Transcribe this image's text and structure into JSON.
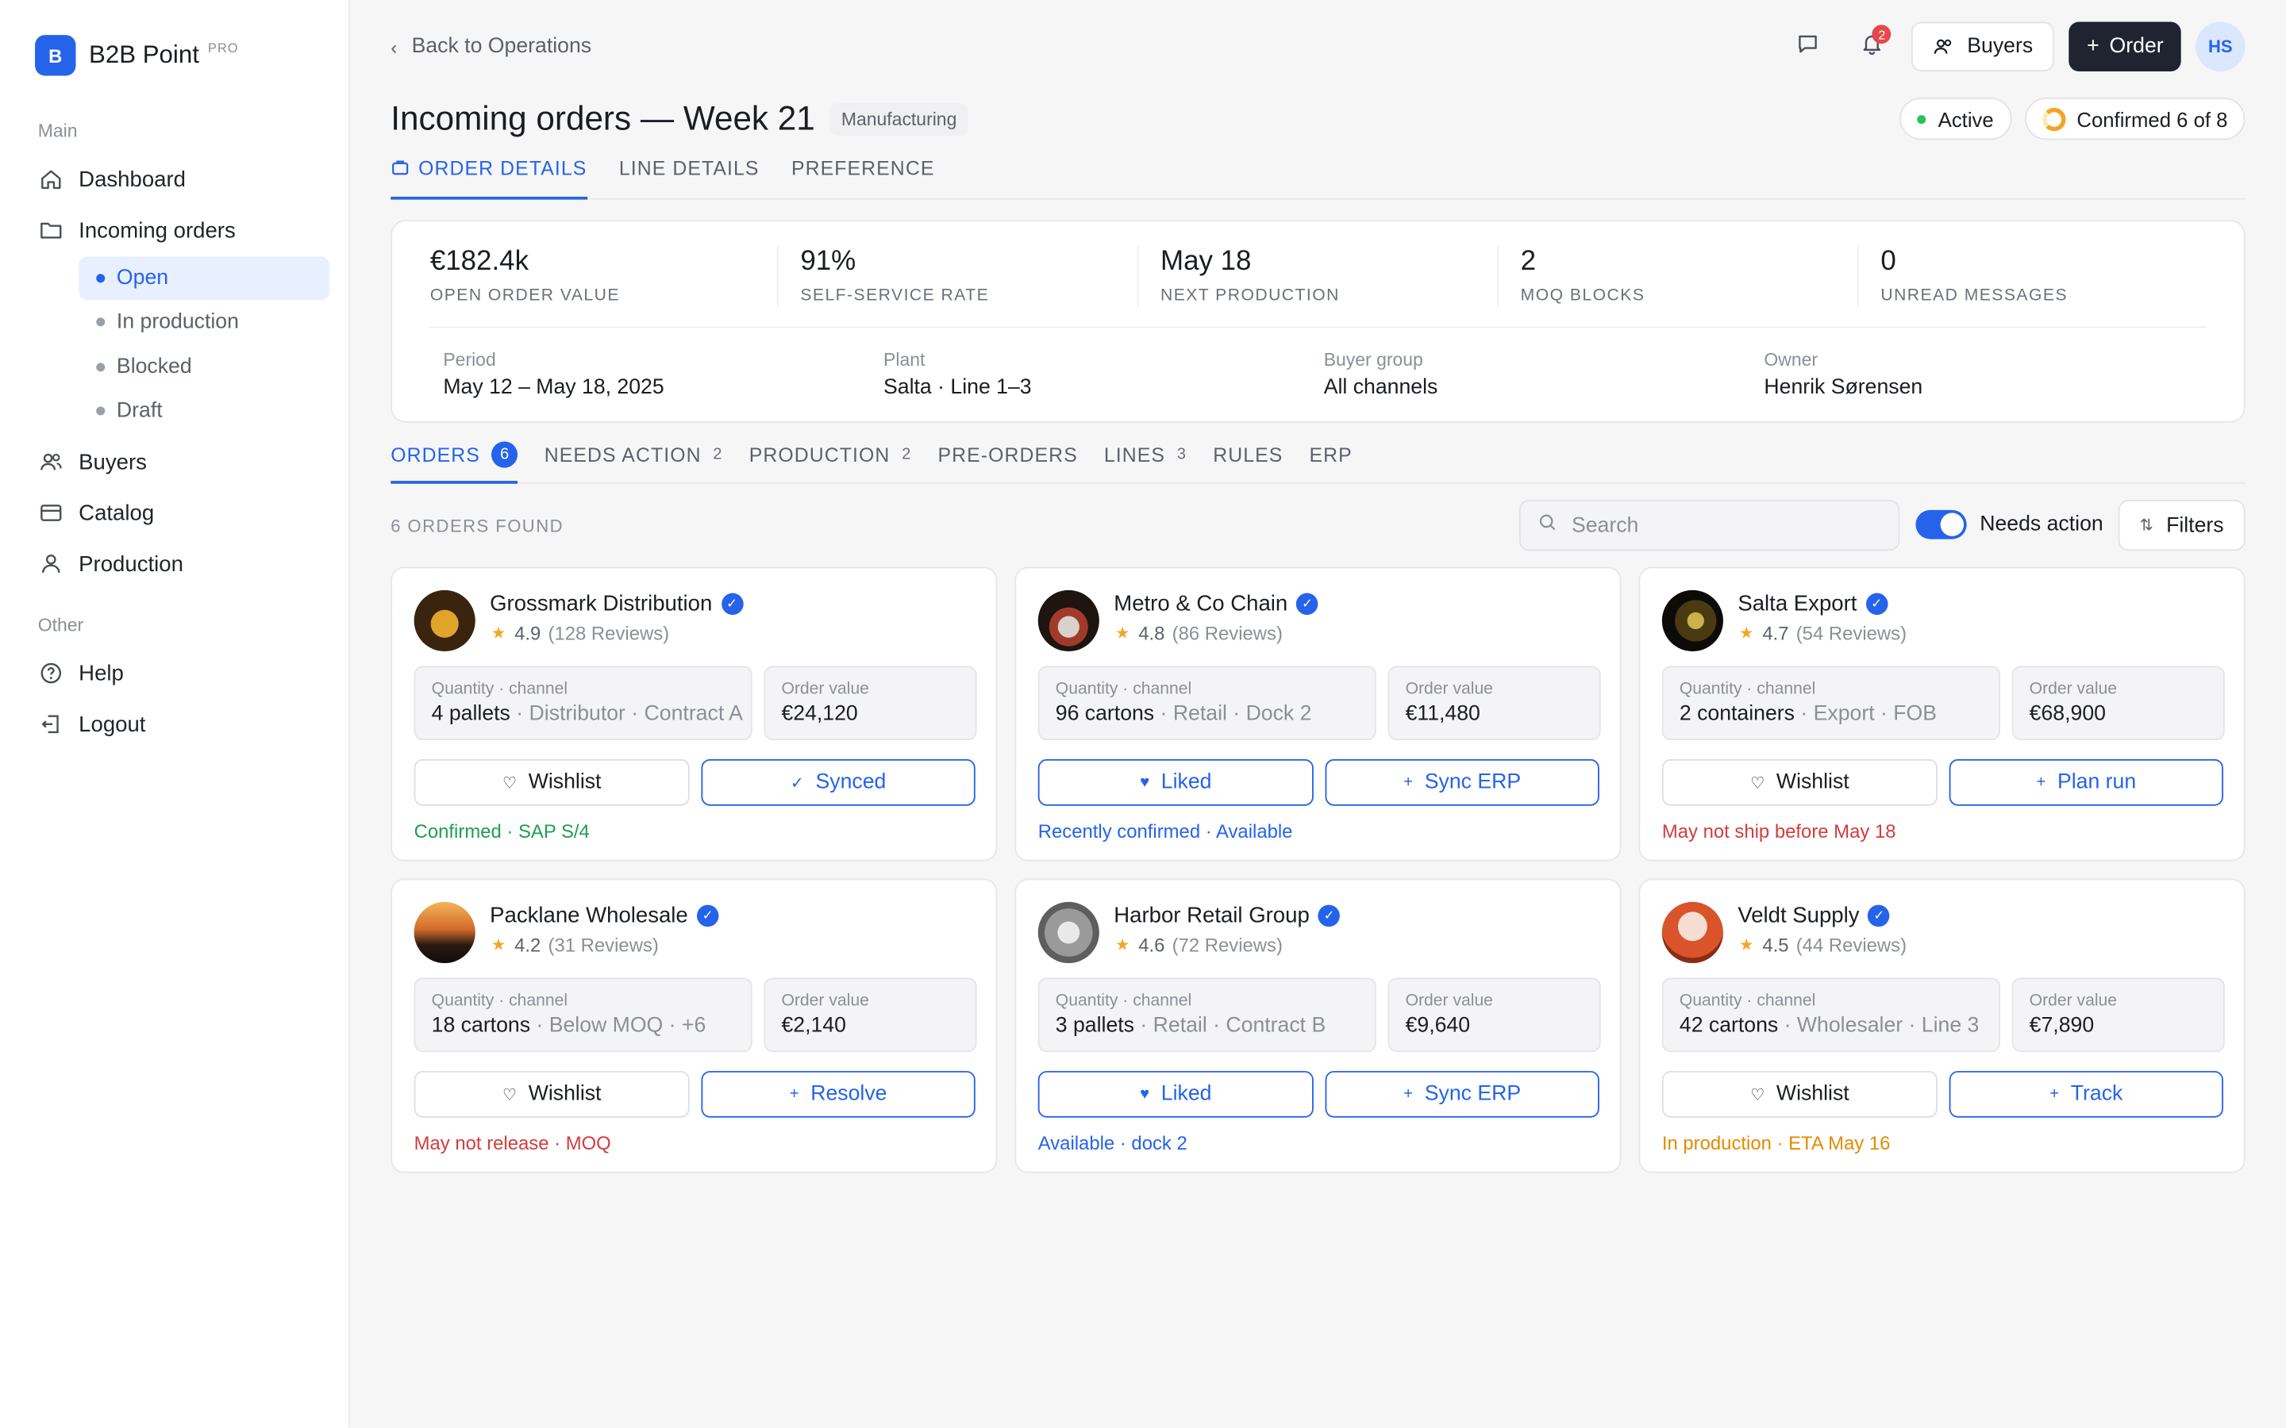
{
  "brand": {
    "logo_letter": "B",
    "name": "B2B Point",
    "badge": "PRO"
  },
  "sidebar": {
    "section_main": "Main",
    "section_other": "Other",
    "items": [
      {
        "label": "Dashboard",
        "icon": "home-icon"
      },
      {
        "label": "Incoming orders",
        "icon": "folder-icon"
      },
      {
        "label": "Buyers",
        "icon": "users-icon"
      },
      {
        "label": "Catalog",
        "icon": "card-icon"
      },
      {
        "label": "Production",
        "icon": "user-icon"
      }
    ],
    "sub_items": [
      "Open",
      "In production",
      "Blocked",
      "Draft"
    ],
    "active_sub": "Open",
    "other_items": [
      {
        "label": "Help",
        "icon": "help-icon"
      },
      {
        "label": "Logout",
        "icon": "logout-icon"
      }
    ]
  },
  "header": {
    "back_label": "Back to Operations",
    "notification_count": "2",
    "buyers_label": "Buyers",
    "order_label": "Order",
    "avatar_initials": "HS",
    "title": "Incoming orders — Week 21",
    "tag": "Manufacturing",
    "status_active": "Active",
    "status_confirmed": "Confirmed 6 of 8"
  },
  "top_tabs": [
    "ORDER DETAILS",
    "LINE DETAILS",
    "PREFERENCE"
  ],
  "summary": {
    "kpis": [
      {
        "value": "€182.4k",
        "label": "OPEN ORDER VALUE"
      },
      {
        "value": "91%",
        "label": "SELF-SERVICE RATE"
      },
      {
        "value": "May 18",
        "label": "NEXT PRODUCTION"
      },
      {
        "value": "2",
        "label": "MOQ BLOCKS"
      },
      {
        "value": "0",
        "label": "UNREAD MESSAGES"
      }
    ],
    "meta": [
      {
        "label": "Period",
        "value": "May 12 – May 18, 2025"
      },
      {
        "label": "Plant",
        "value": "Salta · Line 1–3"
      },
      {
        "label": "Buyer group",
        "value": "All channels"
      },
      {
        "label": "Owner",
        "value": "Henrik Sørensen"
      }
    ]
  },
  "sub_tabs": [
    {
      "label": "ORDERS",
      "count": "6"
    },
    {
      "label": "NEEDS ACTION",
      "count": "2"
    },
    {
      "label": "PRODUCTION",
      "count": "2"
    },
    {
      "label": "PRE-ORDERS",
      "count": ""
    },
    {
      "label": "LINES",
      "count": "3"
    },
    {
      "label": "RULES",
      "count": ""
    },
    {
      "label": "ERP",
      "count": ""
    }
  ],
  "toolbar": {
    "found_text": "6 ORDERS FOUND",
    "search_placeholder": "Search",
    "toggle_label": "Needs action",
    "toggle_on": true,
    "filters_label": "Filters"
  },
  "cards": [
    {
      "name": "Grossmark Distribution",
      "rating": "4.9",
      "reviews": "(128 Reviews)",
      "qty_label": "Quantity · channel",
      "qty_main": "4 pallets",
      "qty_rest": " · Distributor · Contract A",
      "value_label": "Order value",
      "value": "€24,120",
      "btn1": "Wishlist",
      "btn1_icon": "heart-outline-icon",
      "btn1_style": "gray",
      "btn2": "Synced",
      "btn2_icon": "check-icon",
      "footer": "Confirmed · SAP S/4",
      "footer_color": "green"
    },
    {
      "name": "Metro & Co Chain",
      "rating": "4.8",
      "reviews": "(86 Reviews)",
      "qty_label": "Quantity · channel",
      "qty_main": "96 cartons",
      "qty_rest": " · Retail · Dock 2",
      "value_label": "Order value",
      "value": "€11,480",
      "btn1": "Liked",
      "btn1_icon": "heart-filled-icon",
      "btn1_style": "blue",
      "btn2": "Sync ERP",
      "btn2_icon": "plus-icon",
      "footer": "Recently confirmed · Available",
      "footer_color": "blue"
    },
    {
      "name": "Salta Export",
      "rating": "4.7",
      "reviews": "(54 Reviews)",
      "qty_label": "Quantity · channel",
      "qty_main": "2 containers",
      "qty_rest": " · Export · FOB",
      "value_label": "Order value",
      "value": "€68,900",
      "btn1": "Wishlist",
      "btn1_icon": "heart-outline-icon",
      "btn1_style": "gray",
      "btn2": "Plan run",
      "btn2_icon": "plus-icon",
      "footer": "May not ship before May 18",
      "footer_color": "red"
    },
    {
      "name": "Packlane Wholesale",
      "rating": "4.2",
      "reviews": "(31 Reviews)",
      "qty_label": "Quantity · channel",
      "qty_main": "18 cartons",
      "qty_rest": " · Below MOQ · +6",
      "value_label": "Order value",
      "value": "€2,140",
      "btn1": "Wishlist",
      "btn1_icon": "heart-outline-icon",
      "btn1_style": "gray",
      "btn2": "Resolve",
      "btn2_icon": "plus-icon",
      "footer": "May not release · MOQ",
      "footer_color": "red"
    },
    {
      "name": "Harbor Retail Group",
      "rating": "4.6",
      "reviews": "(72 Reviews)",
      "qty_label": "Quantity · channel",
      "qty_main": "3 pallets",
      "qty_rest": " · Retail · Contract B",
      "value_label": "Order value",
      "value": "€9,640",
      "btn1": "Liked",
      "btn1_icon": "heart-filled-icon",
      "btn1_style": "blue",
      "btn2": "Sync ERP",
      "btn2_icon": "plus-icon",
      "footer": "Available · dock 2",
      "footer_color": "blue"
    },
    {
      "name": "Veldt Supply",
      "rating": "4.5",
      "reviews": "(44 Reviews)",
      "qty_label": "Quantity · channel",
      "qty_main": "42 cartons",
      "qty_rest": " · Wholesaler · Line 3",
      "value_label": "Order value",
      "value": "€7,890",
      "btn1": "Wishlist",
      "btn1_icon": "heart-outline-icon",
      "btn1_style": "gray",
      "btn2": "Track",
      "btn2_icon": "plus-icon",
      "footer": "In production · ETA May 16",
      "footer_color": "orange"
    }
  ],
  "colors": {
    "accent": "#2563eb",
    "dark_button": "#1f2430",
    "success": "#1f9d55",
    "danger": "#d43c3c",
    "warning": "#e58a00"
  }
}
